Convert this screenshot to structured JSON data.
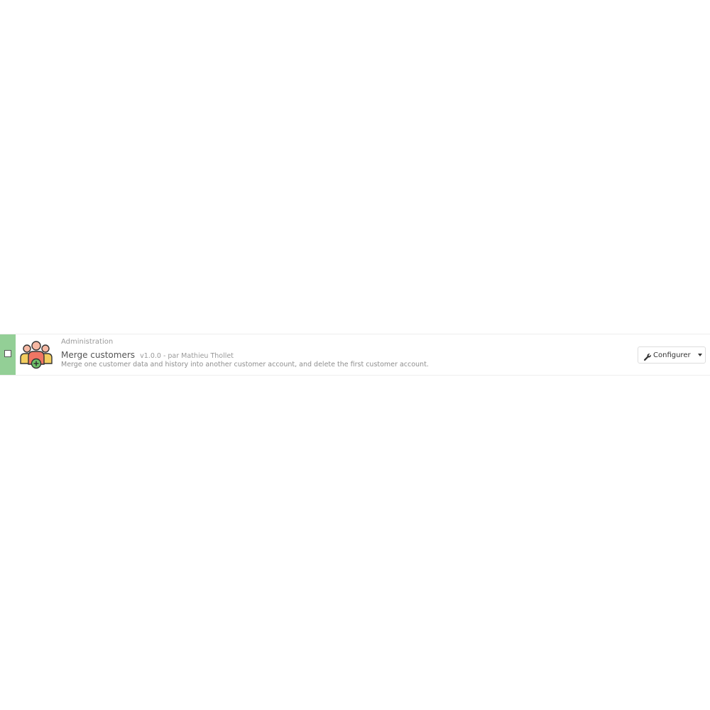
{
  "module": {
    "category": "Administration",
    "name": "Merge customers",
    "meta": "v1.0.0 - par Mathieu Thollet",
    "description": "Merge one customer data and history into another customer account, and delete the first customer account.",
    "icon": "users-merge-icon",
    "status_color": "#93cf96"
  },
  "actions": {
    "configure_label": "Configurer",
    "configure_icon": "wrench-icon",
    "dropdown_icon": "caret-down-icon"
  }
}
